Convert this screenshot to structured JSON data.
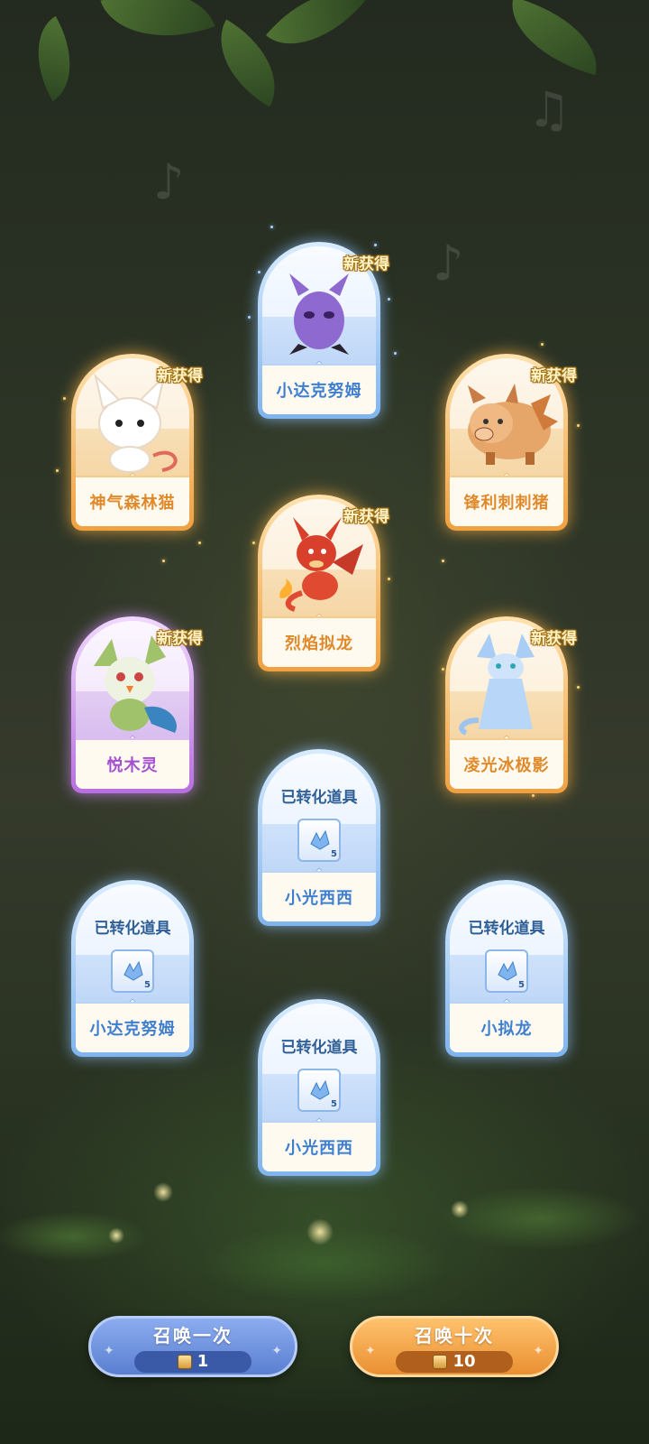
{
  "new_tag": "新获得",
  "converted_title": "已转化道具",
  "cards": [
    {
      "id": "card-1",
      "name": "小达克努姆",
      "rarity": "blue",
      "new": true,
      "converted": false
    },
    {
      "id": "card-2",
      "name": "神气森林猫",
      "rarity": "orange",
      "new": true,
      "converted": false
    },
    {
      "id": "card-3",
      "name": "锋利刺刺猪",
      "rarity": "orange",
      "new": true,
      "converted": false
    },
    {
      "id": "card-4",
      "name": "烈焰拟龙",
      "rarity": "orange",
      "new": true,
      "converted": false
    },
    {
      "id": "card-5",
      "name": "悦木灵",
      "rarity": "purple",
      "new": true,
      "converted": false
    },
    {
      "id": "card-6",
      "name": "凌光冰极影",
      "rarity": "orange",
      "new": true,
      "converted": false
    },
    {
      "id": "card-7",
      "name": "小光西西",
      "rarity": "blue",
      "new": false,
      "converted": true,
      "item_qty": "5"
    },
    {
      "id": "card-8",
      "name": "小达克努姆",
      "rarity": "blue",
      "new": false,
      "converted": true,
      "item_qty": "5"
    },
    {
      "id": "card-9",
      "name": "小拟龙",
      "rarity": "blue",
      "new": false,
      "converted": true,
      "item_qty": "5"
    },
    {
      "id": "card-10",
      "name": "小光西西",
      "rarity": "blue",
      "new": false,
      "converted": true,
      "item_qty": "5"
    }
  ],
  "buttons": {
    "summon_once": {
      "label": "召唤一次",
      "cost": "1"
    },
    "summon_ten": {
      "label": "召唤十次",
      "cost": "10"
    }
  },
  "colors": {
    "orange": "#f0a040",
    "blue": "#7fb4ee",
    "purple": "#b86ee0"
  }
}
